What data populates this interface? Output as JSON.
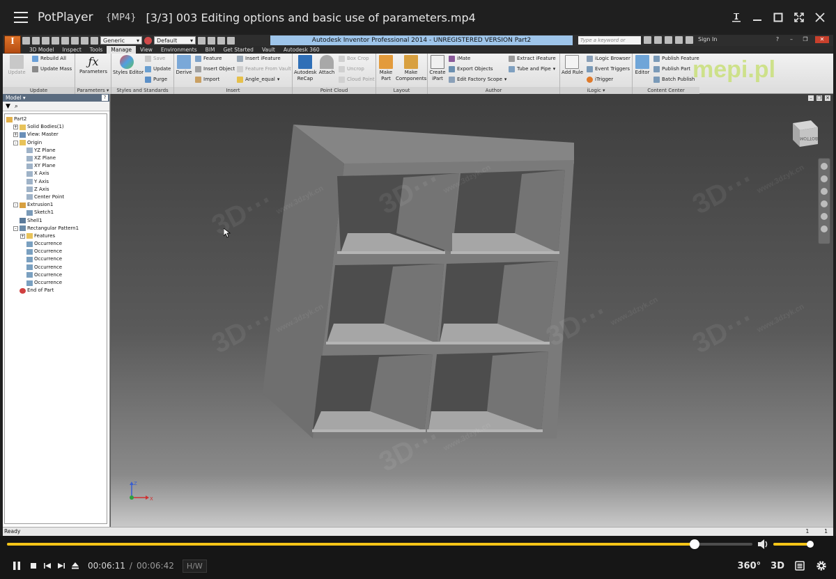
{
  "player": {
    "app_name": "PotPlayer",
    "format_badge": "{MP4}",
    "file_title": "[3/3] 003 Editing options and basic use of parameters.mp4",
    "time_current": "00:06:11",
    "time_separator": "/",
    "time_total": "00:06:42",
    "hw_label": "H/W",
    "btn_360": "360°",
    "btn_3d": "3D",
    "seek_progress_fraction": 0.922,
    "volume_fraction": 0.92,
    "accent_color": "#f5c518"
  },
  "inventor": {
    "app_title": "Autodesk Inventor Professional 2014 - UNREGISTERED VERSION    Part2",
    "logo_letter": "I",
    "logo_sub": "PRO",
    "material_select": "Generic",
    "appearance_select": "Default",
    "search_placeholder": "Type a keyword or phrase",
    "sign_in": "Sign In",
    "tabs": [
      "3D Model",
      "Inspect",
      "Tools",
      "Manage",
      "View",
      "Environments",
      "BIM",
      "Get Started",
      "Vault",
      "Autodesk 360"
    ],
    "active_tab": "Manage",
    "ribbon": {
      "update": {
        "label": "Update",
        "buttons": [
          "Update",
          "Rebuild All",
          "Update Mass"
        ]
      },
      "parameters": {
        "label": "Parameters ▾",
        "buttons": [
          "Parameters"
        ]
      },
      "styles": {
        "label": "Styles and Standards",
        "buttons": [
          "Styles Editor",
          "Save",
          "Update",
          "Purge"
        ]
      },
      "insert": {
        "label": "Insert",
        "buttons": [
          "Derive",
          "Feature",
          "Insert Object",
          "Import",
          "Insert iFeature",
          "Feature From Vault",
          "Angle_equal"
        ]
      },
      "point_cloud": {
        "label": "Point Cloud",
        "buttons": [
          "Autodesk ReCap",
          "Attach",
          "Box Crop",
          "Uncrop",
          "Cloud Point"
        ]
      },
      "layout": {
        "label": "Layout",
        "buttons": [
          "Make Part",
          "Make Components"
        ]
      },
      "author": {
        "label": "Author",
        "buttons": [
          "Create iPart",
          "iMate",
          "Export Objects",
          "Edit Factory Scope",
          "Extract iFeature",
          "Tube and Pipe"
        ]
      },
      "ilogic": {
        "label": "iLogic ▾",
        "buttons": [
          "Add Rule",
          "iLogic Browser",
          "Event Triggers",
          "iTrigger"
        ]
      },
      "content_center": {
        "label": "Content Center",
        "buttons": [
          "Editor",
          "Publish Feature",
          "Publish Part",
          "Batch Publish"
        ]
      }
    },
    "browser": {
      "title": "Model ▾",
      "help": "?",
      "tree": [
        {
          "label": "Part2",
          "depth": 0,
          "icon": "part-icon"
        },
        {
          "label": "Solid Bodies(1)",
          "depth": 1,
          "icon": "folder-icon",
          "expand": "+"
        },
        {
          "label": "View: Master",
          "depth": 1,
          "icon": "view-icon",
          "expand": "+"
        },
        {
          "label": "Origin",
          "depth": 1,
          "icon": "folder-icon",
          "expand": "-"
        },
        {
          "label": "YZ Plane",
          "depth": 2,
          "icon": "plane-icon"
        },
        {
          "label": "XZ Plane",
          "depth": 2,
          "icon": "plane-icon"
        },
        {
          "label": "XY Plane",
          "depth": 2,
          "icon": "plane-icon"
        },
        {
          "label": "X Axis",
          "depth": 2,
          "icon": "axis-icon"
        },
        {
          "label": "Y Axis",
          "depth": 2,
          "icon": "axis-icon"
        },
        {
          "label": "Z Axis",
          "depth": 2,
          "icon": "axis-icon"
        },
        {
          "label": "Center Point",
          "depth": 2,
          "icon": "point-icon"
        },
        {
          "label": "Extrusion1",
          "depth": 1,
          "icon": "extrusion-icon",
          "expand": "-"
        },
        {
          "label": "Sketch1",
          "depth": 2,
          "icon": "sketch-icon"
        },
        {
          "label": "Shell1",
          "depth": 1,
          "icon": "shell-icon"
        },
        {
          "label": "Rectangular Pattern1",
          "depth": 1,
          "icon": "pattern-icon",
          "expand": "-"
        },
        {
          "label": "Features",
          "depth": 2,
          "icon": "folder-icon",
          "expand": "+"
        },
        {
          "label": "Occurrence",
          "depth": 2,
          "icon": "occurrence-icon"
        },
        {
          "label": "Occurrence",
          "depth": 2,
          "icon": "occurrence-icon"
        },
        {
          "label": "Occurrence",
          "depth": 2,
          "icon": "occurrence-icon"
        },
        {
          "label": "Occurrence",
          "depth": 2,
          "icon": "occurrence-icon"
        },
        {
          "label": "Occurrence",
          "depth": 2,
          "icon": "occurrence-icon"
        },
        {
          "label": "Occurrence",
          "depth": 2,
          "icon": "occurrence-icon"
        },
        {
          "label": "End of Part",
          "depth": 1,
          "icon": "end-of-part-icon"
        }
      ]
    },
    "viewcube_label": "BOTTOM",
    "triad": {
      "x": "X",
      "z": "Z"
    },
    "status": {
      "text": "Ready",
      "right_a": "1",
      "right_b": "1"
    },
    "watermark_brand": "mepi.pl",
    "watermark_site": "www.3dzyk.cn"
  }
}
